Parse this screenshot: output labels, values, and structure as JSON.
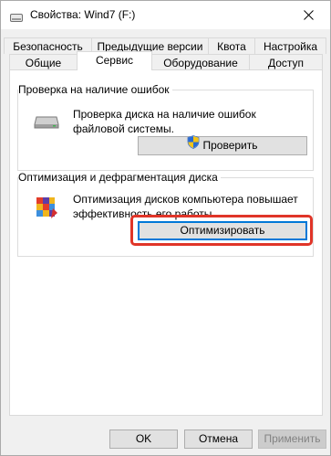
{
  "window": {
    "title": "Свойства: Wind7 (F:)"
  },
  "tabs": {
    "row1": [
      {
        "label": "Безопасность"
      },
      {
        "label": "Предыдущие версии"
      },
      {
        "label": "Квота"
      },
      {
        "label": "Настройка"
      }
    ],
    "row2": [
      {
        "label": "Общие"
      },
      {
        "label": "Сервис",
        "selected": true
      },
      {
        "label": "Оборудование"
      },
      {
        "label": "Доступ"
      }
    ]
  },
  "error_check": {
    "title": "Проверка на наличие ошибок",
    "description": "Проверка диска на наличие ошибок файловой системы.",
    "button_label": "Проверить",
    "icon": "drive-icon"
  },
  "optimize": {
    "title": "Оптимизация и дефрагментация диска",
    "description": "Оптимизация дисков компьютера повышает эффективность его работы.",
    "button_label": "Оптимизировать",
    "icon": "defrag-icon"
  },
  "footer": {
    "ok_label": "OK",
    "cancel_label": "Отмена",
    "apply_label": "Применить"
  },
  "colors": {
    "highlight": "#e03528",
    "focus": "#0078d7"
  }
}
